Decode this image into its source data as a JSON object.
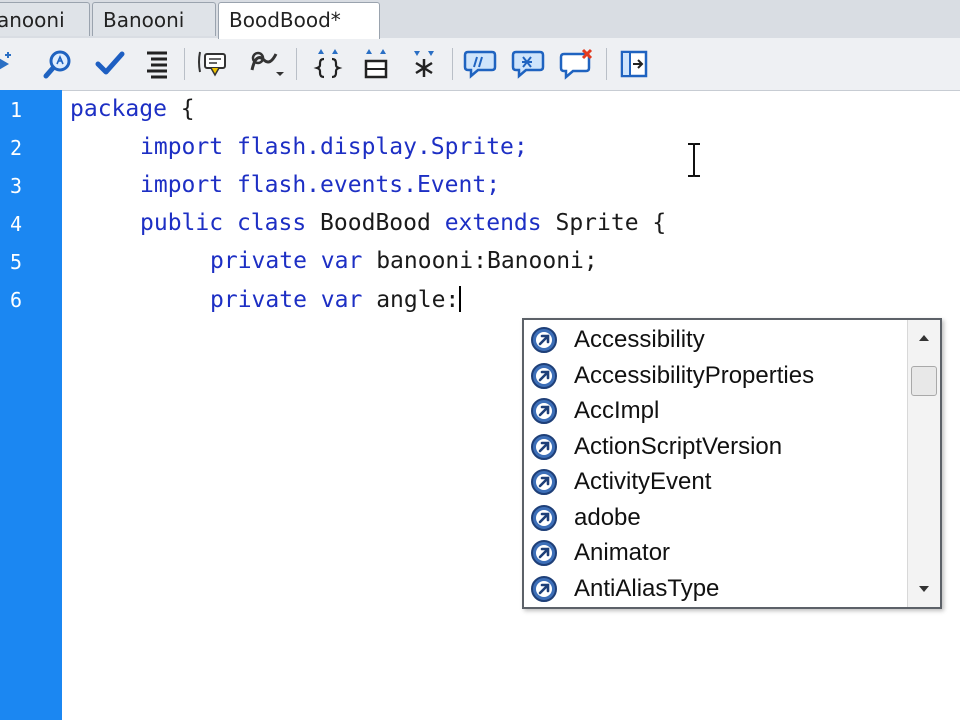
{
  "tabs": [
    {
      "label": "anooni"
    },
    {
      "label": "Banooni"
    },
    {
      "label": "BoodBood*"
    }
  ],
  "toolbar": {
    "icons": [
      "add-icon",
      "find-icon",
      "check-syntax-icon",
      "auto-format-icon",
      "show-code-hint-icon",
      "debug-options-icon",
      "collapse-braces-icon",
      "collapse-selection-icon",
      "expand-all-icon",
      "apply-comment-icon",
      "apply-block-comment-icon",
      "remove-comment-icon",
      "toggle-panel-icon"
    ]
  },
  "editor": {
    "line_numbers": [
      "1",
      "2",
      "3",
      "4",
      "5",
      "6"
    ],
    "lines": [
      {
        "kw1": "package",
        "text": " {"
      },
      {
        "kw1": "import",
        "text": " flash.display.Sprite;"
      },
      {
        "kw1": "import",
        "text": " flash.events.Event;"
      },
      {
        "kw1": "public",
        "kw2": "class",
        "mid": " BoodBood ",
        "kw3": "extends",
        "text": " Sprite {"
      },
      {
        "kw1": "private",
        "kw2": "var",
        "text": " banooni:Banooni;"
      },
      {
        "kw1": "private",
        "kw2": "var",
        "text": " angle:"
      }
    ]
  },
  "autocomplete": {
    "items": [
      "Accessibility",
      "AccessibilityProperties",
      "AccImpl",
      "ActionScriptVersion",
      "ActivityEvent",
      "adobe",
      "Animator",
      "AntiAliasType"
    ],
    "item_icon": "class-hint-icon"
  },
  "colors": {
    "keyword": "#1d2fc4",
    "gutter": "#1b87f2"
  }
}
